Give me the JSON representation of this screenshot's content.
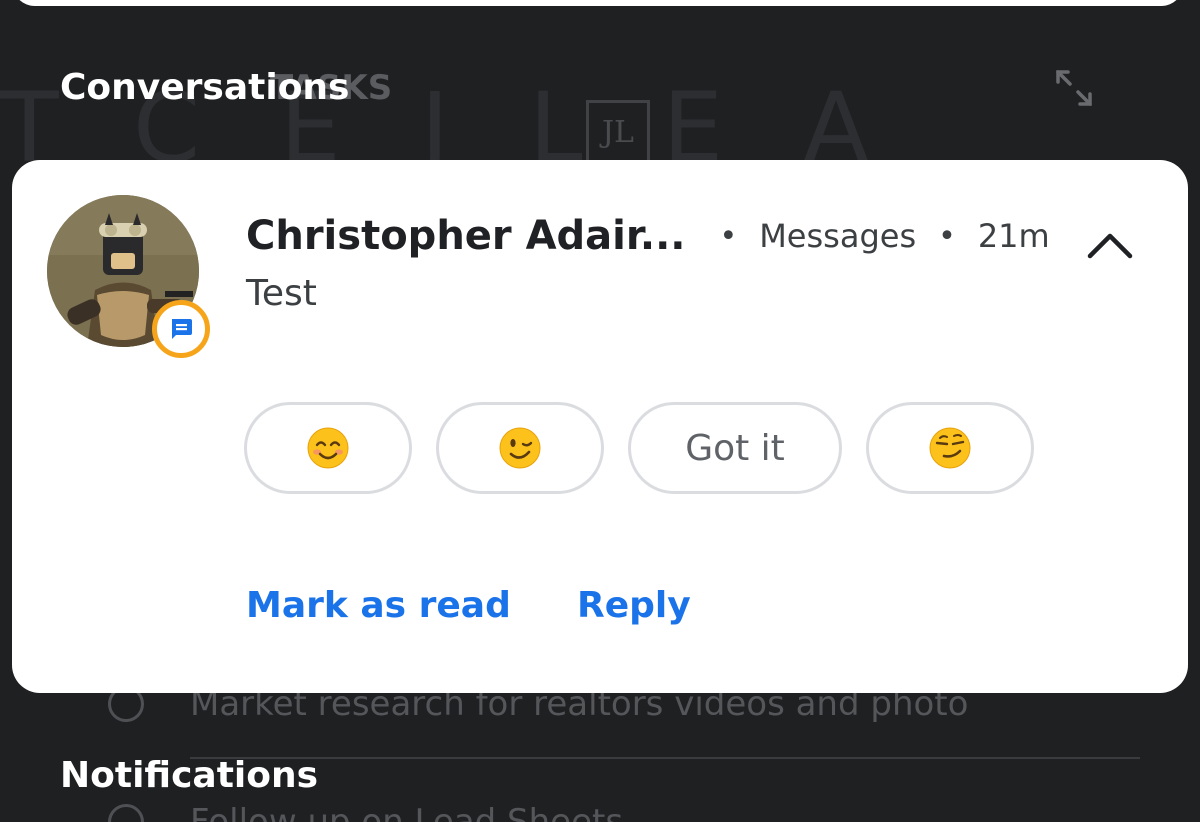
{
  "sections": {
    "conversations_label": "Conversations",
    "notifications_label": "Notifications"
  },
  "background": {
    "widget_title": "TASKS",
    "tasks": [
      {
        "text": "Market research for realtors videos and photo"
      },
      {
        "text": "Follow up on Lead Sheets"
      }
    ]
  },
  "notification": {
    "sender": "Christopher Adair...",
    "app_name": "Messages",
    "time": "21m",
    "message": "Test",
    "smart_replies": [
      {
        "type": "emoji",
        "icon": "smiling-face-with-smiling-eyes-emoji"
      },
      {
        "type": "emoji",
        "icon": "winking-face-emoji"
      },
      {
        "type": "text",
        "label": "Got it"
      },
      {
        "type": "emoji",
        "icon": "smirking-face-emoji"
      }
    ],
    "actions": {
      "mark_as_read": "Mark as read",
      "reply": "Reply"
    },
    "badge_icon": "messages-app-icon",
    "collapse_icon": "chevron-up-icon"
  },
  "colors": {
    "background": "#1f2022",
    "card": "#ffffff",
    "action_blue": "#1a73e8",
    "badge_ring": "#f6a51b",
    "badge_icon": "#1a73e8",
    "chip_border": "#dadce0"
  }
}
